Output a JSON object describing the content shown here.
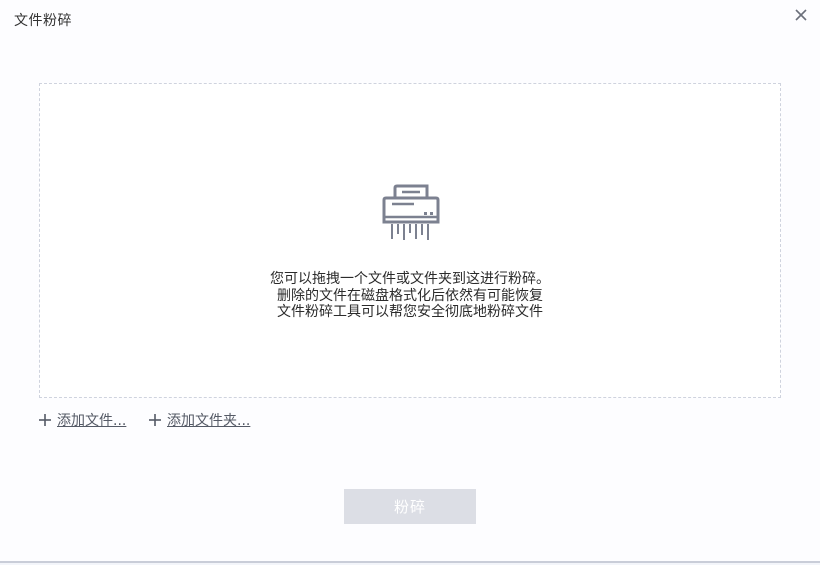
{
  "window": {
    "title": "文件粉碎"
  },
  "drop_zone": {
    "line1": "您可以拖拽一个文件或文件夹到这进行粉碎。",
    "line2": "删除的文件在磁盘格式化后依然有可能恢复",
    "line3": "文件粉碎工具可以帮您安全彻底地粉碎文件",
    "icon": "shredder-icon"
  },
  "actions": {
    "add_files_label": "添加文件...",
    "add_folder_label": "添加文件夹..."
  },
  "footer": {
    "shred_button_label": "粉碎",
    "shred_button_enabled": false
  },
  "colors": {
    "icon": "#7c8190",
    "button_disabled": "#dcdee5",
    "dashed_border": "#cfd3de"
  }
}
